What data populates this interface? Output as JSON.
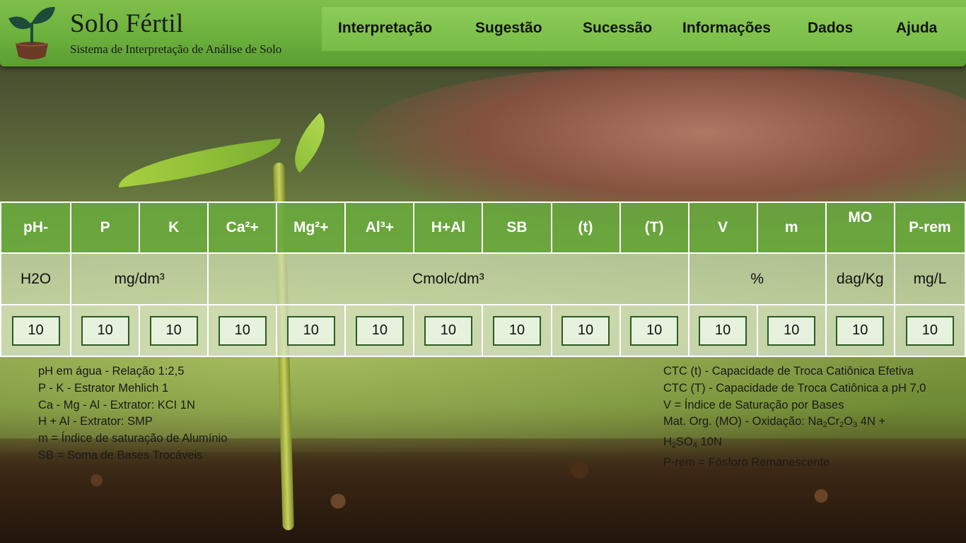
{
  "brand": {
    "title": "Solo Fértil",
    "subtitle": "Sistema de Interpretação de Análise de Solo"
  },
  "nav": {
    "items": [
      {
        "label": "Interpretação"
      },
      {
        "label": "Sugestão"
      },
      {
        "label": "Sucessão"
      },
      {
        "label": "Informações"
      },
      {
        "label": "Dados"
      },
      {
        "label": "Ajuda"
      }
    ]
  },
  "table": {
    "headers": [
      "pH-",
      "P",
      "K",
      "Ca²+",
      "Mg²+",
      "Al³+",
      "H+Al",
      "SB",
      "(t)",
      "(T)",
      "V",
      "m",
      "MO",
      "P-rem"
    ],
    "units": {
      "ph": "H2O",
      "pk": "mg/dm³",
      "cmolc": "Cmolc/dm³",
      "percent": "%",
      "mo": "dag/Kg",
      "prem": "mg/L"
    },
    "values": [
      "10",
      "10",
      "10",
      "10",
      "10",
      "10",
      "10",
      "10",
      "10",
      "10",
      "10",
      "10",
      "10",
      "10"
    ]
  },
  "notes_left": [
    "pH em água - Relação 1:2,5",
    "P - K - Estrator Mehlich 1",
    "Ca - Mg - Al - Extrator: KCI 1N",
    "H + Al - Extrator: SMP",
    "m = Índice de saturação de Alumínio",
    "SB = Soma de Bases Trocáveis"
  ],
  "notes_right": {
    "line1": "CTC (t) - Capacidade de Troca Catiônica Efetiva",
    "line2": "CTC (T) - Capacidade de Troca Catiônica a pH 7,0",
    "line3": "V = Índice de Saturação por Bases",
    "line4_prefix": "Mat. Org. (MO) - Oxidação: Na",
    "line4_sub1": "2",
    "line4_mid1": "Cr",
    "line4_sub2": "2",
    "line4_mid2": "O",
    "line4_sub3": "3",
    "line4_suffix": " 4N +",
    "line5_prefix": "H",
    "line5_sub1": "2",
    "line5_mid": "SO",
    "line5_sub2": "4",
    "line5_suffix": " 10N",
    "line6": "P-rem = Fósforo Remanescente"
  }
}
